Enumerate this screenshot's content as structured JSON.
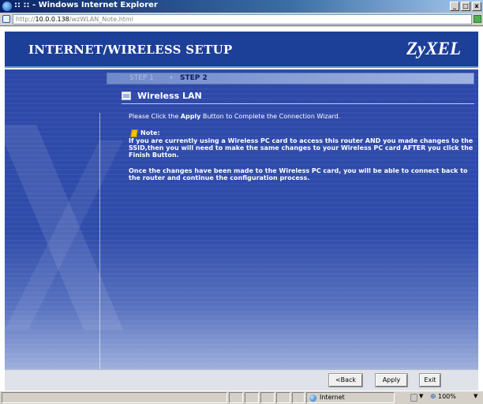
{
  "window": {
    "title": ":: :: - Windows Internet Explorer",
    "minimize": "_",
    "maximize": "□",
    "close": "x"
  },
  "address": {
    "prefix": "http://",
    "host": "10.0.0.138",
    "path": "/wzWLAN_Note.html"
  },
  "header": {
    "title": "INTERNET/WIRELESS SETUP",
    "logo": "ZyXEL"
  },
  "steps": {
    "step1": "STEP 1",
    "arrow": "›",
    "step2": "STEP 2"
  },
  "section": {
    "title": "Wireless LAN"
  },
  "instruction": {
    "before": "Please Click the ",
    "bold": "Apply",
    "after": " Button to Complete the Connection Wizard."
  },
  "note": {
    "label": "Note:",
    "body": "If you are currently using a Wireless PC card to access this router AND you made changes to the SSID,then you will need to make the same changes to your Wireless PC card AFTER you click the Finish Button.",
    "body2": "Once the changes have been made to the Wireless PC card, you will be able to connect back to the router and continue the configuration process."
  },
  "buttons": {
    "back": "<Back",
    "apply": "Apply",
    "exit": "Exit"
  },
  "status": {
    "zone": "Internet",
    "zoom": "100%",
    "dropdown": "▼"
  },
  "colors": {
    "header_bg": "#1c3f97",
    "content_bg": "#2f4cab"
  }
}
